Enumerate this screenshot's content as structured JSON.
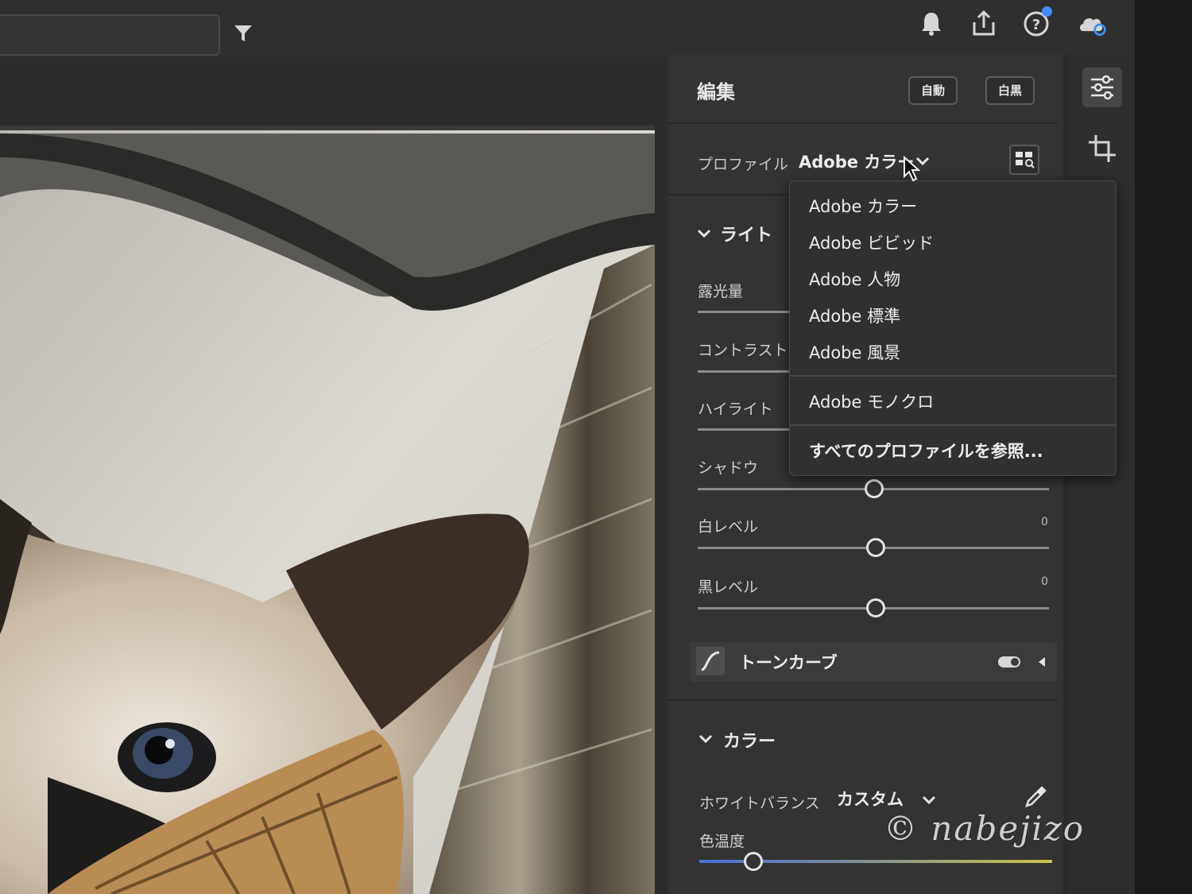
{
  "edit_panel": {
    "title": "編集",
    "auto_label": "自動",
    "bw_label": "白黒",
    "profile_label": "プロファイル",
    "profile_value": "Adobe カラー"
  },
  "profile_menu": {
    "items": [
      "Adobe カラー",
      "Adobe ビビッド",
      "Adobe 人物",
      "Adobe 標準",
      "Adobe 風景"
    ],
    "mono": "Adobe モノクロ",
    "browse": "すべてのプロファイルを参照..."
  },
  "light": {
    "heading": "ライト",
    "sliders": [
      {
        "label": "露光量",
        "value": ""
      },
      {
        "label": "コントラスト",
        "value": ""
      },
      {
        "label": "ハイライト",
        "value": ""
      },
      {
        "label": "シャドウ",
        "value": ""
      },
      {
        "label": "白レベル",
        "value": "0"
      },
      {
        "label": "黒レベル",
        "value": "0"
      }
    ]
  },
  "tone_curve": {
    "label": "トーンカーブ"
  },
  "color": {
    "heading": "カラー",
    "wb_label": "ホワイトバランス",
    "wb_value": "カスタム",
    "temp_label": "色温度"
  },
  "watermark": "© nabejizo",
  "icons": {
    "filter": "filter-icon",
    "bell": "bell-icon",
    "share": "share-icon",
    "help": "help-icon",
    "cloud": "cloud-sync-icon",
    "edit": "sliders-icon",
    "crop": "crop-icon",
    "grid": "profile-browser-icon",
    "eyedropper": "eyedropper-icon"
  },
  "colors": {
    "accent": "#3d8ef7",
    "panel": "#323332",
    "dropdown": "#2f302f"
  }
}
